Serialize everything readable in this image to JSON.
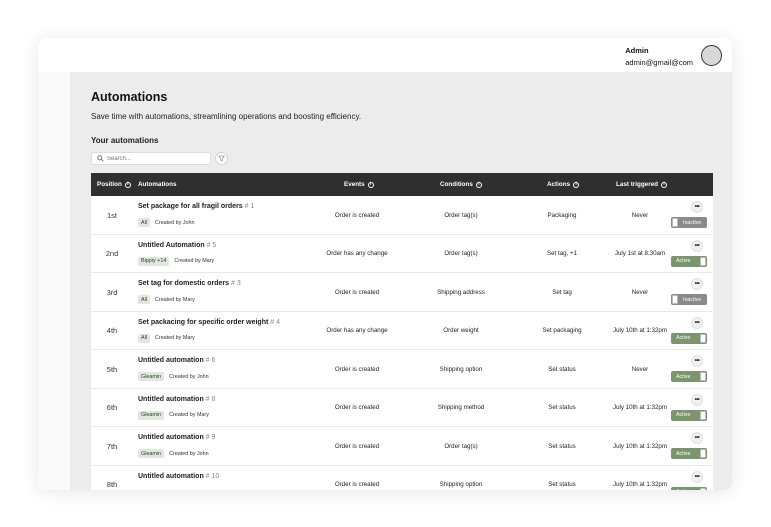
{
  "user": {
    "name": "Admin",
    "email": "admin@gmail@com"
  },
  "page": {
    "title": "Automations",
    "subtitle": "Save time with automations, streamlining operations and boosting efficiency.",
    "section_title": "Your automations",
    "search_placeholder": "Search..."
  },
  "colors": {
    "header_bg": "#2f2f2f",
    "active": "#7c9470",
    "inactive": "#8a8a8a",
    "tag_bg": "#dfe8dc"
  },
  "table": {
    "headers": {
      "position": "Position",
      "automations": "Automations",
      "events": "Events",
      "conditions": "Conditions",
      "actions": "Actions",
      "last_triggered": "Last triggered"
    },
    "rows": [
      {
        "position": "1st",
        "name": "Set package for all fragil orders",
        "num": "# 1",
        "tag": "All",
        "creator": "Created by John",
        "event": "Order is created",
        "condition": "Order tag(s)",
        "action": "Packaging",
        "last": "Never",
        "status": "Inactive"
      },
      {
        "position": "2nd",
        "name": "Untitled Automation",
        "num": "# 5",
        "tag": "Bippiy +14",
        "creator": "Created by Mary",
        "event": "Order has any change",
        "condition": "Order tag(s)",
        "action": "Set tag, +1",
        "last": "July 1st at 8:30am",
        "status": "Active"
      },
      {
        "position": "3rd",
        "name": "Set tag for domestic orders",
        "num": "# 3",
        "tag": "All",
        "creator": "Created by Mary",
        "event": "Order is created",
        "condition": "Shipping address",
        "action": "Set tag",
        "last": "Never",
        "status": "Inactive"
      },
      {
        "position": "4th",
        "name": "Set packacing for specific order weight",
        "num": "# 4",
        "tag": "All",
        "creator": "Created by Mary",
        "event": "Order has any change",
        "condition": "Order weight",
        "action": "Set packaging",
        "last": "July 10th at 1:32pm",
        "status": "Active"
      },
      {
        "position": "5th",
        "name": "Untitled automation",
        "num": "# 6",
        "tag": "Gleamin",
        "creator": "Created by John",
        "event": "Order is created",
        "condition": "Shipping option",
        "action": "Set status",
        "last": "Never",
        "status": "Active"
      },
      {
        "position": "6th",
        "name": "Untitled automation",
        "num": "# 8",
        "tag": "Gleamin",
        "creator": "Created by Mary",
        "event": "Order is created",
        "condition": "Shipping method",
        "action": "Set status",
        "last": "July 10th at 1:32pm",
        "status": "Active"
      },
      {
        "position": "7th",
        "name": "Untitled automation",
        "num": "# 9",
        "tag": "Gleamin",
        "creator": "Created by John",
        "event": "Order is created",
        "condition": "Order tag(s)",
        "action": "Set status",
        "last": "July 10th at 1:32pm",
        "status": "Active"
      },
      {
        "position": "8th",
        "name": "Untitled automation",
        "num": "# 10",
        "tag": "",
        "creator": "",
        "event": "Order is created",
        "condition": "Shipping option",
        "action": "Set status",
        "last": "July 10th at 1:32pm",
        "status": "Active"
      }
    ]
  }
}
